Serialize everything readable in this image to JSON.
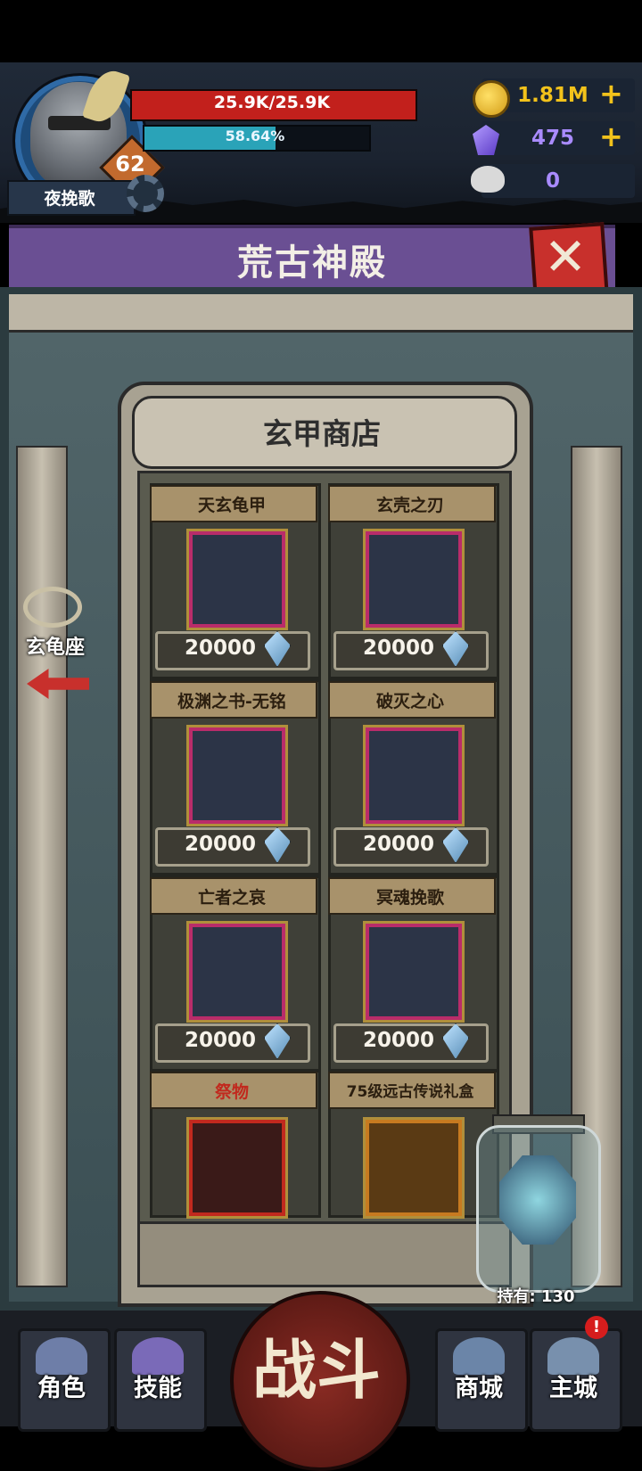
{
  "player": {
    "name": "夜挽歌",
    "level": "62",
    "hp_text": "25.9K/25.9K",
    "xp_text": "58.64%",
    "xp_fraction": 0.5864
  },
  "resources": {
    "gold": "1.81M",
    "gems": "475",
    "offerings": "0",
    "add_symbol": "+"
  },
  "page": {
    "title": "荒古神殿",
    "close_symbol": "✕"
  },
  "shop": {
    "title": "玄甲商店",
    "items": [
      {
        "name": "天玄龟甲",
        "price": "20000"
      },
      {
        "name": "玄壳之刃",
        "price": "20000"
      },
      {
        "name": "极渊之书-无铭",
        "price": "20000"
      },
      {
        "name": "破灭之心",
        "price": "20000"
      },
      {
        "name": "亡者之哀",
        "price": "20000"
      },
      {
        "name": "冥魂挽歌",
        "price": "20000"
      },
      {
        "name": "祭物"
      },
      {
        "name": "75级远古传说礼盒"
      }
    ]
  },
  "side_nav": {
    "label": "玄龟座"
  },
  "holdings": {
    "text": "持有: 130"
  },
  "bottom_nav": {
    "role": "角色",
    "skill": "技能",
    "battle": "战斗",
    "store": "商城",
    "main_city": "主城",
    "notif": "!"
  },
  "colors": {
    "hp": "#c2201c",
    "xp": "#2aa3b8",
    "gold": "#f2c21b",
    "gems": "#a98bff",
    "banner": "#6a4f93"
  },
  "icons": [
    "coin-icon",
    "gem-icon",
    "ram-skull-icon",
    "gear-icon",
    "close-icon",
    "crystal-icon",
    "arrow-left-icon"
  ]
}
